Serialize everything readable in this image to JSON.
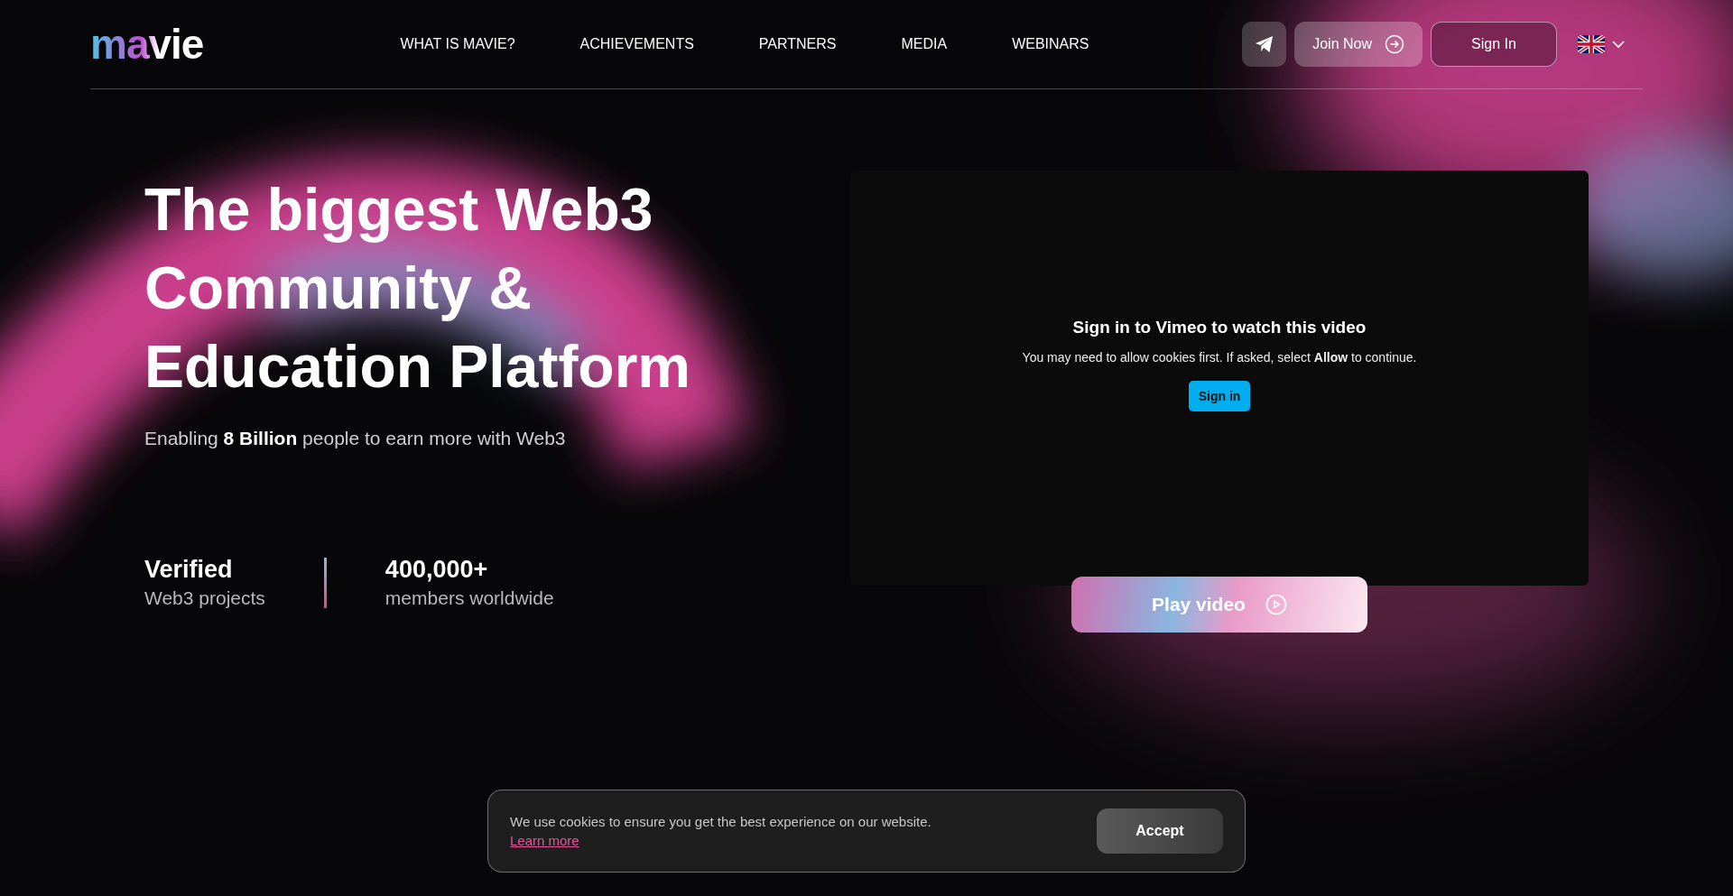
{
  "header": {
    "logo": "mavie",
    "nav": [
      {
        "label": "WHAT IS MAVIE?"
      },
      {
        "label": "ACHIEVEMENTS"
      },
      {
        "label": "PARTNERS"
      },
      {
        "label": "MEDIA"
      },
      {
        "label": "WEBINARS"
      }
    ],
    "join_button": "Join Now",
    "sign_in_button": "Sign In"
  },
  "hero": {
    "title_lines": [
      "The biggest Web3",
      "Community &",
      "Education Platform"
    ],
    "subtitle": "Enabling **8 Billion** people to earn more with Web3",
    "stats": [
      {
        "value": "Verified",
        "label": "Web3 projects"
      },
      {
        "value": "400,000+",
        "label": "members worldwide"
      }
    ]
  },
  "video": {
    "heading": "Sign in to Vimeo to watch this video",
    "message": "You may need to allow cookies first. If asked, select **Allow** to continue.",
    "sign_in_button": "Sign in",
    "play_button": "Play video"
  },
  "cookie_banner": {
    "message": "We use cookies to ensure you get the best experience on our website.",
    "link": "Learn more",
    "accept_button": "Accept"
  }
}
